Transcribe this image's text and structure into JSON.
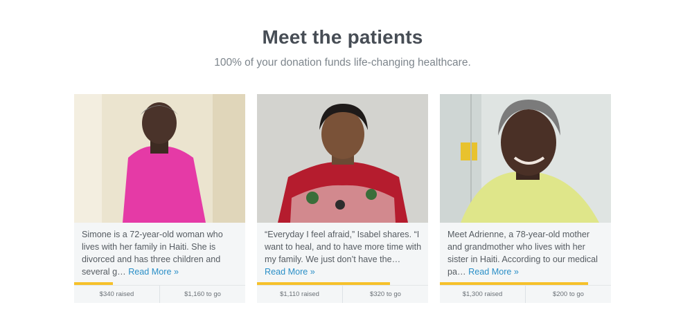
{
  "header": {
    "title": "Meet the patients",
    "subtitle": "100% of your donation funds life-changing healthcare."
  },
  "patients": [
    {
      "story": "Simone is a 72-year-old woman who lives with her family in Haiti. She is divorced and has three children and several g…",
      "read_more": "Read More »",
      "raised": "$340 raised",
      "to_go": "$1,160 to go",
      "progress": 0.227
    },
    {
      "story": "“Everyday I feel afraid,” Isabel shares. “I want to heal, and to have more time with my family. We just don’t have the…",
      "read_more": "Read More »",
      "raised": "$1,110 raised",
      "to_go": "$320 to go",
      "progress": 0.776
    },
    {
      "story": "Meet Adrienne, a 78-year-old mother and grandmother who lives with her sister in Haiti. According to our medical pa…",
      "read_more": "Read More »",
      "raised": "$1,300 raised",
      "to_go": "$200 to go",
      "progress": 0.867
    }
  ],
  "colors": {
    "accent_link": "#2a8fc7",
    "progress": "#f6c12b",
    "card_bg": "#f4f6f7"
  }
}
